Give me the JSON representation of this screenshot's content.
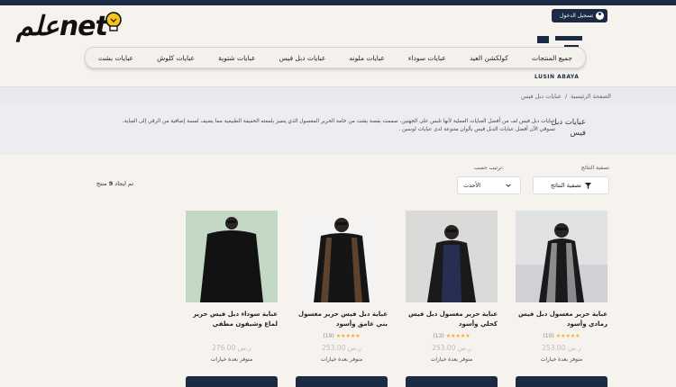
{
  "watermark": {
    "text": "علمnet"
  },
  "header": {
    "login_label": "تسجيل الدخول",
    "logo_text": "LUSIN ABAYA"
  },
  "nav": {
    "items": [
      "جميع المنتجات",
      "كولكشن العيد",
      "عبايات سوداء",
      "عبايات ملونه",
      "عبايات دبل فيس",
      "عبايات شتوية",
      "عبايات كلوش",
      "عبايات بشت"
    ]
  },
  "breadcrumb": {
    "home": "الصفحة الرئيسية",
    "separator": "/",
    "current": "عبايات دبل فيس"
  },
  "category": {
    "title": "عبايات دبل فيس",
    "description": "عبايات دبل فيس لف من أفضل العبايات العملية لأنها تلبس على الجهتين، صممت بقصة بشت من خامة الحرير المغسول الذي يتميز بلمعته الخفيفة الطبيعية مما يضيف لمسة إضافية من الرقي إلى العباية. تسوقي الآن أفضل عبايات الدبل فيس بألوان متنوعة لدى عبايات لوسين ."
  },
  "toolbar": {
    "filter_heading": "تصفية النتائج",
    "filter_button": "تصفية النتائج",
    "sort_heading": "ترتيب حسب:",
    "sort_value": "الأحدث",
    "results_prefix": "تم ايجاد",
    "results_count": "9",
    "results_suffix": "منتج"
  },
  "products": [
    {
      "name": "عباية حرير مغسول دبل فيس رمادي وأسود",
      "rating": 5,
      "stars": "★★★★★",
      "reviews": "(10)",
      "price": "253.00 ر.س",
      "availability": "متوفر بعدة خيارات"
    },
    {
      "name": "عباية حرير مغسول دبل فيس كحلي وأسود",
      "rating": 5,
      "stars": "★★★★★",
      "reviews": "(13)",
      "price": "253.00 ر.س",
      "availability": "متوفر بعدة خيارات"
    },
    {
      "name": "عباية دبل فيس حرير مغسول بني غامق وأسود",
      "rating": 5,
      "stars": "★★★★★",
      "reviews": "(19)",
      "price": "253.00 ر.س",
      "availability": "متوفر بعدة خيارات"
    },
    {
      "name": "عباية سوداء دبل فيس حرير لماع وشيفون مطفي",
      "rating": null,
      "stars": "",
      "reviews": "",
      "price": "276.00 ر.س",
      "availability": "متوفر بعدة خيارات"
    }
  ],
  "colors": {
    "navy": "#1c2a44",
    "page_bg": "#f6f3ee",
    "star": "#f2b01e"
  }
}
